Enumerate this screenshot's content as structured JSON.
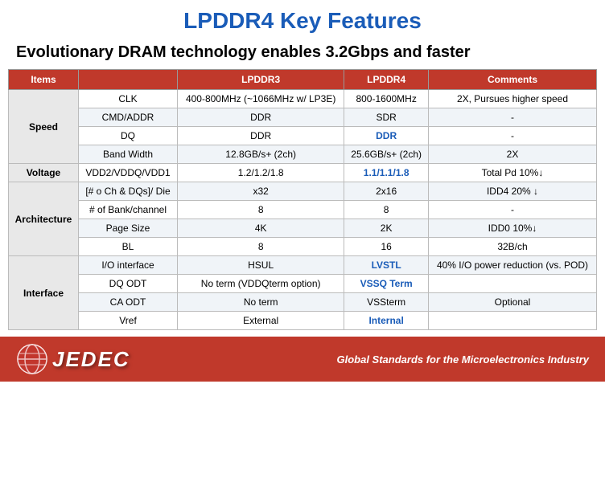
{
  "header": {
    "main_title": "LPDDR4 Key Features",
    "sub_title": "Evolutionary DRAM technology enables 3.2Gbps and faster"
  },
  "table": {
    "columns": [
      "Items",
      "LPDDR3",
      "LPDDR4",
      "Comments"
    ],
    "sections": [
      {
        "section_label": "Speed",
        "rows": [
          {
            "item": "CLK",
            "lpddr3": "400-800MHz (~1066MHz w/ LP3E)",
            "lpddr4": "800-1600MHz",
            "lpddr4_blue": false,
            "comments": "2X, Pursues higher speed"
          },
          {
            "item": "CMD/ADDR",
            "lpddr3": "DDR",
            "lpddr4": "SDR",
            "lpddr4_blue": false,
            "comments": "-"
          },
          {
            "item": "DQ",
            "lpddr3": "DDR",
            "lpddr4": "DDR",
            "lpddr4_blue": true,
            "comments": "-"
          },
          {
            "item": "Band Width",
            "lpddr3": "12.8GB/s+ (2ch)",
            "lpddr4": "25.6GB/s+ (2ch)",
            "lpddr4_blue": false,
            "comments": "2X"
          }
        ]
      },
      {
        "section_label": "Voltage",
        "rows": [
          {
            "item": "VDD2/VDDQ/VDD1",
            "lpddr3": "1.2/1.2/1.8",
            "lpddr4": "1.1/1.1/1.8",
            "lpddr4_blue": true,
            "comments": "Total Pd 10%↓"
          }
        ]
      },
      {
        "section_label": "Architecture",
        "rows": [
          {
            "item": "[# o Ch  &  DQs]/ Die",
            "lpddr3": "x32",
            "lpddr4": "2x16",
            "lpddr4_blue": false,
            "comments": "IDD4 20% ↓"
          },
          {
            "item": "# of Bank/channel",
            "lpddr3": "8",
            "lpddr4": "8",
            "lpddr4_blue": false,
            "comments": "-"
          },
          {
            "item": "Page Size",
            "lpddr3": "4K",
            "lpddr4": "2K",
            "lpddr4_blue": false,
            "comments": "IDD0 10%↓"
          },
          {
            "item": "BL",
            "lpddr3": "8",
            "lpddr4": "16",
            "lpddr4_blue": false,
            "comments": "32B/ch"
          }
        ]
      },
      {
        "section_label": "Interface",
        "rows": [
          {
            "item": "I/O interface",
            "lpddr3": "HSUL",
            "lpddr4": "LVSTL",
            "lpddr4_blue": true,
            "comments": "40% I/O power reduction (vs. POD)"
          },
          {
            "item": "DQ ODT",
            "lpddr3": "No term (VDDQterm option)",
            "lpddr4": "VSSQ Term",
            "lpddr4_blue": true,
            "comments": ""
          },
          {
            "item": "CA ODT",
            "lpddr3": "No term",
            "lpddr4": "VSSterm",
            "lpddr4_blue": false,
            "comments": "Optional"
          },
          {
            "item": "Vref",
            "lpddr3": "External",
            "lpddr4": "Internal",
            "lpddr4_blue": true,
            "comments": ""
          }
        ]
      }
    ]
  },
  "footer": {
    "logo_text": "JEDEC",
    "tagline": "Global Standards for the Microelectronics Industry"
  },
  "colors": {
    "header_color": "#c0392b",
    "blue_accent": "#1a5cb8",
    "title_blue": "#1a5cb8"
  }
}
